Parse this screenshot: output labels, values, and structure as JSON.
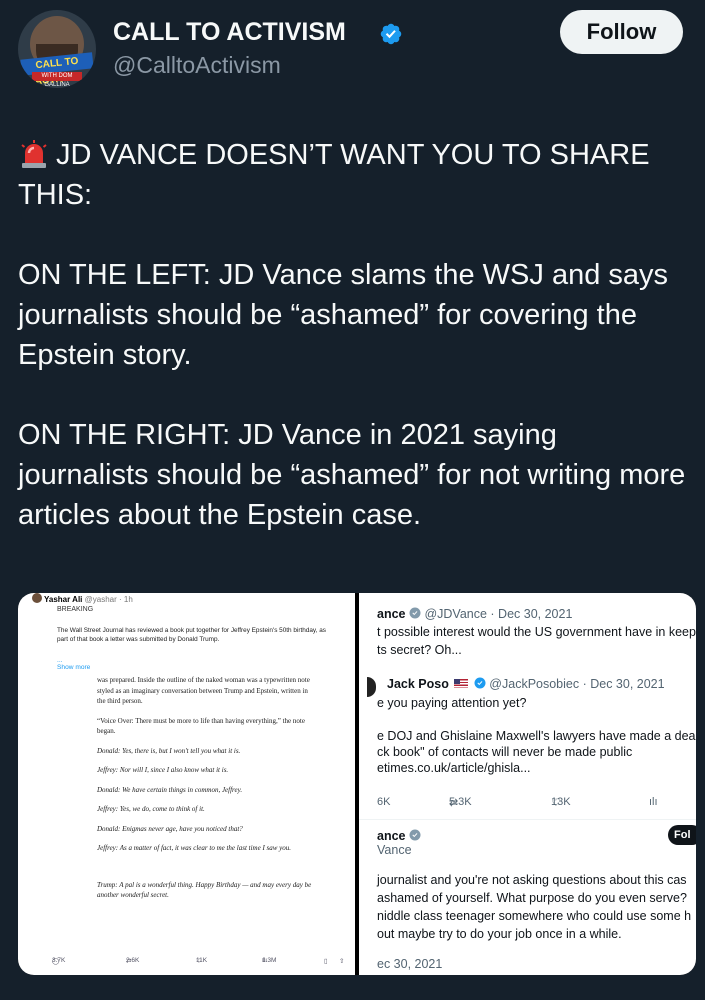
{
  "account": {
    "name": "CALL TO ACTIVISM",
    "handle": "@CalltoActivism",
    "avatar_banner": "CALL TO ACTIVISM",
    "avatar_subbanner": "WITH DOM GALLINA"
  },
  "follow_label": "Follow",
  "post": {
    "lines": [
      "JD VANCE DOESN’T WANT YOU TO SHARE THIS:",
      "",
      "ON THE LEFT: JD Vance slams the WSJ and says journalists should be “ashamed” for covering the Epstein story.",
      "",
      "ON THE RIGHT: JD Vance in 2021 saying  journalists should be “ashamed” for not writing more articles about the Epstein case."
    ]
  },
  "left_image": {
    "author": "Yashar Ali",
    "handle": "@yashar · 1h",
    "label": "BREAKING",
    "summary": "The Wall Street Journal has reviewed a book put together for Jeffrey Epstein's 50th birthday, as part of that book a letter was submitted by Donald Trump.",
    "ellipsis": "...",
    "show_more": "Show more",
    "book": {
      "p1": "was prepared. Inside the outline of the naked woman was a typewritten note styled as an imaginary conversation between Trump and Epstein, written in the third person.",
      "p2": "“Voice Over: There must be more to life than having everything,” the note began.",
      "d1": "Donald: Yes, there is, but I won't tell you what it is.",
      "d2": "Jeffrey: Nor will I, since I also know what it is.",
      "d3": "Donald: We have certain things in common, Jeffrey.",
      "d4": "Jeffrey: Yes, we do, come to think of it.",
      "d5": "Donald: Enigmas never age, have you noticed that?",
      "d6": "Jeffrey: As a matter of fact, it was clear to me the last time I saw you.",
      "d7": "Trump: A pal is a wonderful thing. Happy Birthday — and may every day be another wonderful secret."
    },
    "actions": {
      "replies": "3.7K",
      "reposts": "2.6K",
      "likes": "11K",
      "views": "1.3M"
    }
  },
  "right_image": {
    "t1_name": "ance",
    "t1_meta": "@JDVance · Dec 30, 2021",
    "t1_line1": "t possible interest would the US government have in keeping Ep",
    "t1_line2": "ts secret? Oh...",
    "t2_name": "Jack Poso",
    "t2_meta": "@JackPosobiec · Dec 30, 2021",
    "t2_line1": "e you paying attention yet?",
    "t2_line2": "e DOJ and Ghislaine Maxwell's lawyers have made a deal that he",
    "t2_line3": "ck book\" of contacts will never be made public",
    "t2_line4": "etimes.co.uk/article/ghisla...",
    "actions": {
      "replies": "6K",
      "reposts": "5.3K",
      "likes": "13K"
    },
    "t3_name": "ance",
    "t3_sub": "Vance",
    "t3_follow": "Fol",
    "t3_line1": "journalist and you're not asking questions about this cas",
    "t3_line2": "ashamed of yourself. What purpose do you even serve?",
    "t3_line3": "niddle class teenager somewhere who could use some h",
    "t3_line4": "out maybe try to do your job once in a while.",
    "t3_date": "ec 30, 2021"
  },
  "colors": {
    "background": "#15202b",
    "text": "#f7f9f9",
    "muted": "#8b98a5",
    "verified": "#1d9bf0",
    "siren": "#e0322f"
  },
  "icons": [
    "verified-badge-icon",
    "siren-icon",
    "reply-icon",
    "repost-icon",
    "like-icon",
    "views-icon",
    "bookmark-icon",
    "share-icon"
  ]
}
